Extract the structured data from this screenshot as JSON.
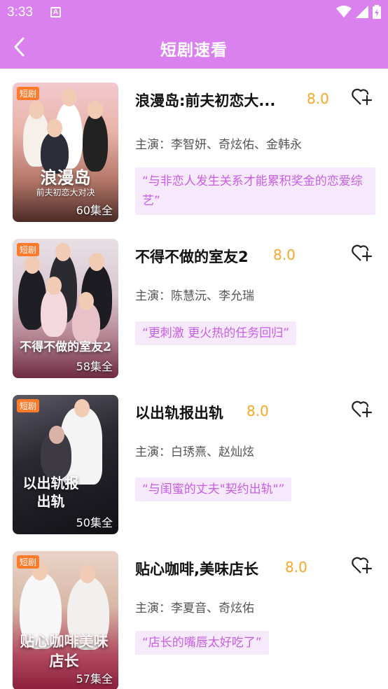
{
  "status_bar": {
    "time": "3:33",
    "notification_icon": "A"
  },
  "app_bar": {
    "title": "短剧速看"
  },
  "colors": {
    "brand": "#da80ef",
    "score": "#f7a823",
    "quote_bg": "#f7e9fc",
    "quote_text": "#c85ee6",
    "tag": "#ff7a2b"
  },
  "items": [
    {
      "tag": "短剧",
      "poster_title": "浪漫岛",
      "poster_subtitle": "前夫初恋大对决",
      "episodes": "60集全",
      "name": "浪漫岛:前夫初恋大...",
      "score": "8.0",
      "cast": "主演：李智妍、奇炫佑、金韩永",
      "quote": "“与非恋人发生关系才能累积奖金的恋爱综艺”"
    },
    {
      "tag": "短剧",
      "poster_title": "不得不做的室友2",
      "poster_subtitle": "",
      "episodes": "58集全",
      "name": "不得不做的室友2",
      "score": "8.0",
      "cast": "主演：陈慧沅、李允瑞",
      "quote": "“更刺激 更火热的任务回归”"
    },
    {
      "tag": "短剧",
      "poster_title": "以出轨报出轨",
      "poster_subtitle": "",
      "episodes": "50集全",
      "name": "以出轨报出轨",
      "score": "8.0",
      "cast": "主演：白琇熹、赵灿炫",
      "quote": "“与闺蜜的丈夫\"契约出轨\"”"
    },
    {
      "tag": "短剧",
      "poster_title": "贴心咖啡美味店长",
      "poster_subtitle": "",
      "episodes": "57集全",
      "name": "贴心咖啡,美味店长",
      "score": "8.0",
      "cast": "主演：李夏音、奇炫佑",
      "quote": "“店长的嘴唇太好吃了”"
    }
  ]
}
